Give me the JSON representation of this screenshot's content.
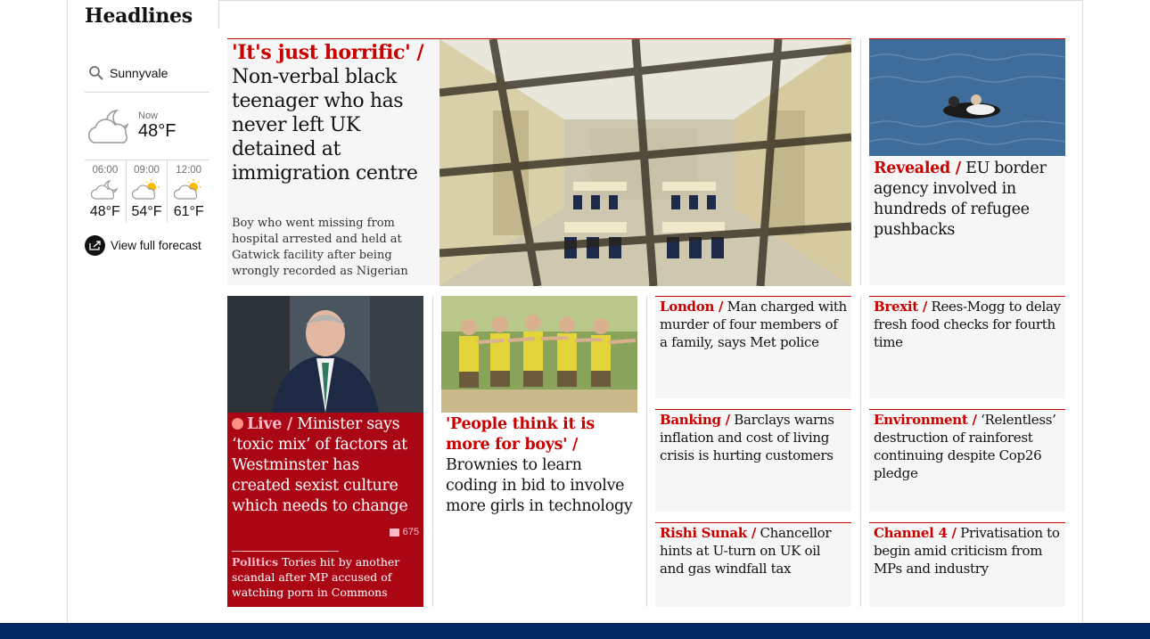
{
  "section": {
    "title": "Headlines"
  },
  "weather": {
    "location": "Sunnyvale",
    "now_label": "Now",
    "now_temp": "48°F",
    "hours": [
      {
        "time": "06:00",
        "temp": "48°F",
        "icon": "cloudy-night-icon"
      },
      {
        "time": "09:00",
        "temp": "54°F",
        "icon": "partly-sunny-icon"
      },
      {
        "time": "12:00",
        "temp": "61°F",
        "icon": "partly-sunny-icon"
      }
    ],
    "forecast_link": "View full forecast"
  },
  "main_story": {
    "kicker": "'It's just horrific' /",
    "headline": "Non-verbal black teenager who has never left UK detained at immigration centre",
    "standfirst": "Boy who went missing from hospital arrested and held at Gatwick facility after being wrongly recorded as Nigerian"
  },
  "eu_story": {
    "kicker": "Revealed /",
    "headline": "EU border agency involved in hundreds of refugee pushbacks"
  },
  "live_story": {
    "kicker": "Live /",
    "headline": "Minister says ‘toxic mix’ of factors at Westminster has created sexist culture which needs to change",
    "comments": "675",
    "sublink_kicker": "Politics",
    "sublink_headline": "Tories hit by another scandal after MP accused of watching porn in Commons"
  },
  "brownies_story": {
    "kicker": "'People think it is more for boys' /",
    "headline": "Brownies to learn coding in bid to involve more girls in technology"
  },
  "small_stories": [
    {
      "kicker": "London /",
      "headline": "Man charged with murder of four members of a family, says Met police"
    },
    {
      "kicker": "Brexit /",
      "headline": "Rees-Mogg to delay fresh food checks for fourth time"
    },
    {
      "kicker": "Banking /",
      "headline": "Barclays warns inflation and cost of living crisis is hurting customers"
    },
    {
      "kicker": "Environment /",
      "headline": "‘Relentless’ destruction of rainforest continuing despite Cop26 pledge"
    },
    {
      "kicker": "Rishi Sunak /",
      "headline": "Chancellor hints at U-turn on UK oil and gas windfall tax"
    },
    {
      "kicker": "Channel 4 /",
      "headline": "Privatisation to begin amid criticism from MPs and industry"
    }
  ],
  "colors": {
    "news_red": "#c70000",
    "live_red": "#ab0613",
    "nav_blue": "#052962"
  }
}
